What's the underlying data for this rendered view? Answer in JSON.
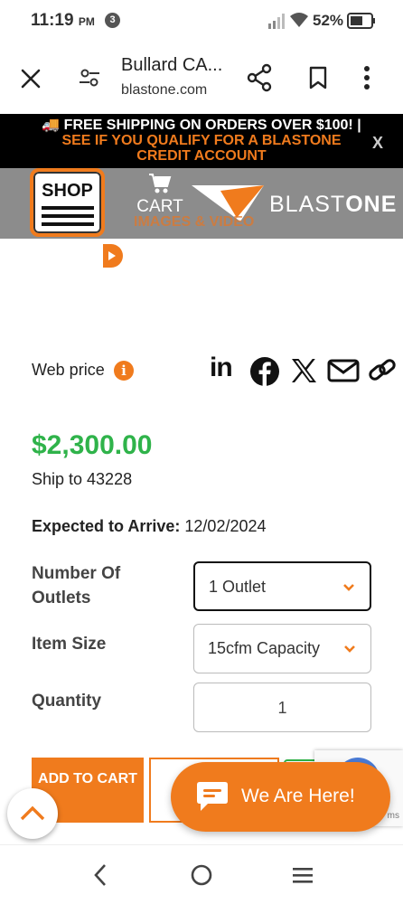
{
  "status_bar": {
    "time": "11:19",
    "ampm": "PM",
    "notification_count": "3",
    "battery": "52%"
  },
  "browser": {
    "title": "Bullard CA...",
    "domain": "blastone.com"
  },
  "promo": {
    "line1": "🚚 FREE SHIPPING ON ORDERS OVER $100! |",
    "line2": "SEE IF YOU QUALIFY FOR A BLASTONE CREDIT ACCOUNT",
    "close": "X"
  },
  "header": {
    "shop_label": "SHOP",
    "cart_label": "CART",
    "logo_light": "BLAST",
    "logo_bold": "ONE",
    "images_video": "IMAGES & VIDEO"
  },
  "product": {
    "web_price_label": "Web price",
    "info_glyph": "i",
    "linkedin_text": "in",
    "price": "$2,300.00",
    "ship_to": "Ship to 43228",
    "expected_label": "Expected to Arrive:",
    "expected_date": "12/02/2024",
    "options": {
      "outlets_label": "Number Of Outlets",
      "outlets_value": "1 Outlet",
      "size_label": "Item Size",
      "size_value": "15cfm Capacity",
      "qty_label": "Quantity",
      "qty_value": "1"
    },
    "add_to_cart": "ADD TO CART"
  },
  "recaptcha": {
    "text": "ms"
  },
  "chat": {
    "label": "We Are Here!"
  },
  "colors": {
    "brand_orange": "#f07b1d",
    "price_green": "#2fb34a",
    "header_gray": "#8c8c8c"
  }
}
